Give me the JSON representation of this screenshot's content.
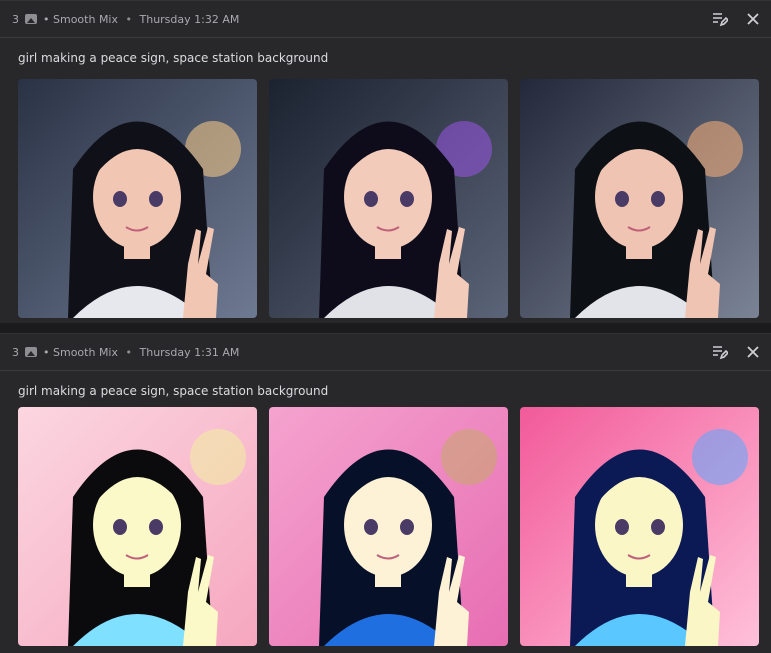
{
  "cards": [
    {
      "count": "3",
      "model": "Smooth Mix",
      "sep": "•",
      "time": "Thursday 1:32 AM",
      "prompt": "girl making a peace sign, space station background",
      "images": [
        {
          "bg_from": "#2a3245",
          "bg_to": "#6e7a92",
          "accent": "#ffcf8a",
          "hair": "#101018",
          "skin": "#f1c7b4",
          "shirt": "#e6e8ee"
        },
        {
          "bg_from": "#1b2230",
          "bg_to": "#5b6478",
          "accent": "#9a55e6",
          "hair": "#0e0c1a",
          "skin": "#f3cbbb",
          "shirt": "#e0e2e8"
        },
        {
          "bg_from": "#23293a",
          "bg_to": "#7b8396",
          "accent": "#ffb27a",
          "hair": "#0d1116",
          "skin": "#f0c4b2",
          "shirt": "#e2e4ea"
        }
      ]
    },
    {
      "count": "3",
      "model": "Smooth Mix",
      "sep": "•",
      "time": "Thursday 1:31 AM",
      "prompt": "girl making a peace sign, space station background",
      "images": [
        {
          "bg_from": "#fbd6e0",
          "bg_to": "#f6a7bf",
          "accent": "#f0f0a0",
          "hair": "#0b0b0d",
          "skin": "#fbf9c8",
          "shirt": "#7fe0ff"
        },
        {
          "bg_from": "#f5a3cf",
          "bg_to": "#e76db2",
          "accent": "#c7a96a",
          "hair": "#071029",
          "skin": "#fdf2d6",
          "shirt": "#1f6fe0"
        },
        {
          "bg_from": "#f25a9a",
          "bg_to": "#ffc1d9",
          "accent": "#5aa8ff",
          "hair": "#0b1a55",
          "skin": "#fbf6c6",
          "shirt": "#5bc7ff"
        }
      ]
    }
  ]
}
